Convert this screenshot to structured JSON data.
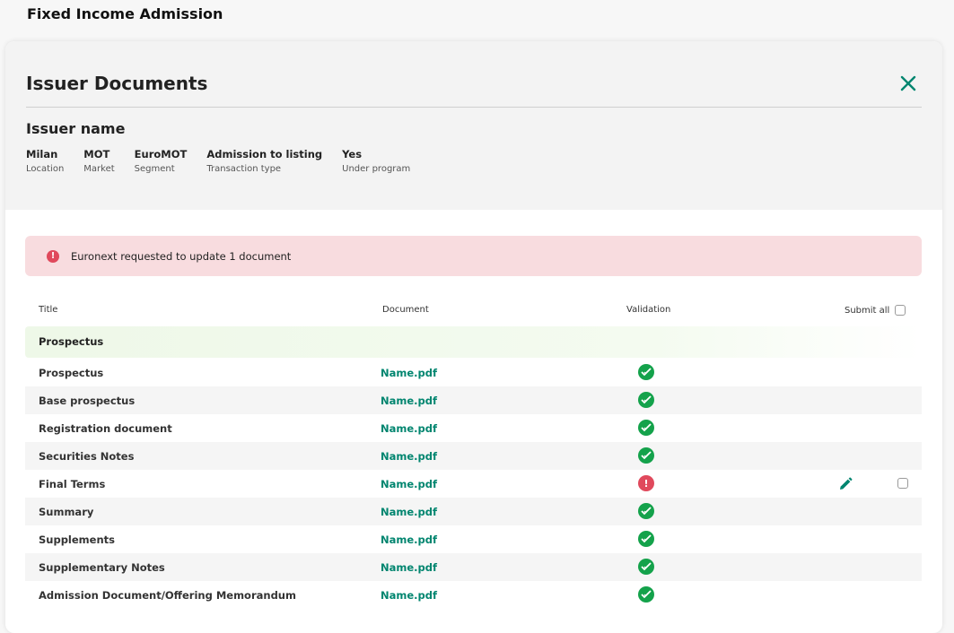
{
  "page": {
    "title": "Fixed Income Admission"
  },
  "modal": {
    "title": "Issuer Documents",
    "issuer_name": "Issuer name",
    "meta": [
      {
        "value": "Milan",
        "label": "Location"
      },
      {
        "value": "MOT",
        "label": "Market"
      },
      {
        "value": "EuroMOT",
        "label": "Segment"
      },
      {
        "value": "Admission to listing",
        "label": "Transaction type"
      },
      {
        "value": "Yes",
        "label": "Under program"
      }
    ]
  },
  "alert": {
    "icon": "exclamation-icon",
    "text": "Euronext requested to update 1 document"
  },
  "table": {
    "headers": {
      "title": "Title",
      "document": "Document",
      "validation": "Validation",
      "submit_all": "Submit all"
    },
    "group": "Prospectus",
    "rows": [
      {
        "title": "Prospectus",
        "document": "Name.pdf",
        "status": "validated"
      },
      {
        "title": "Base prospectus",
        "document": "Name.pdf",
        "status": "validated"
      },
      {
        "title": "Registration document",
        "document": "Name.pdf",
        "status": "validated"
      },
      {
        "title": "Securities Notes",
        "document": "Name.pdf",
        "status": "validated"
      },
      {
        "title": "Final Terms",
        "document": "Name.pdf",
        "status": "update-requested",
        "status_symbol": "!"
      },
      {
        "title": "Summary",
        "document": "Name.pdf",
        "status": "validated"
      },
      {
        "title": "Supplements",
        "document": "Name.pdf",
        "status": "validated"
      },
      {
        "title": "Supplementary Notes",
        "document": "Name.pdf",
        "status": "validated"
      },
      {
        "title": "Admission Document/Offering Memorandum",
        "document": "Name.pdf",
        "status": "validated"
      }
    ]
  },
  "colors": {
    "accent": "#00856f",
    "success": "#14a24b",
    "error": "#e0495c",
    "alert_bg": "#f8dcdf",
    "group_bg": "#eef8e8"
  }
}
